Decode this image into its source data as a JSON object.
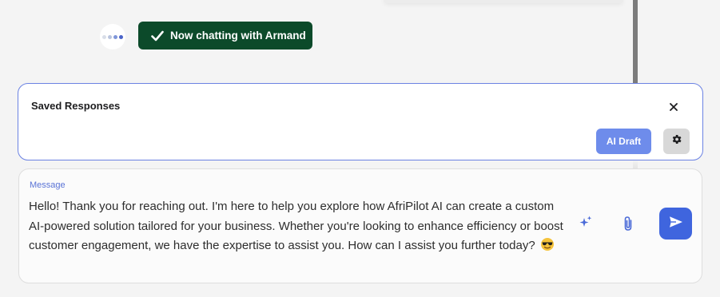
{
  "status": {
    "text": "Now chatting with Armand",
    "icon": "checkmark-icon",
    "color": "#0c4a2a"
  },
  "typing_indicator": {
    "icon": "typing-dots-icon",
    "dot_colors": [
      "#d9dee8",
      "#b9c4de",
      "#7f96d9",
      "#4a63c9"
    ]
  },
  "saved_responses": {
    "title": "Saved Responses",
    "close_icon": "close-icon",
    "ai_draft_label": "AI Draft",
    "settings_icon": "gear-icon",
    "accent": "#6b82e3"
  },
  "composer": {
    "label": "Message",
    "message": "Hello! Thank you for reaching out. I'm here to help you explore how AfriPilot AI can create a custom AI-powered solution tailored for your business. Whether you're looking to enhance efficiency or boost customer engagement, we have the expertise to assist you. How can I assist you further today?",
    "emoji": "smiling-face-with-sunglasses",
    "ai_icon": "sparkle-icon",
    "attach_icon": "paperclip-icon",
    "send_icon": "send-icon",
    "send_color": "#3f65de"
  }
}
